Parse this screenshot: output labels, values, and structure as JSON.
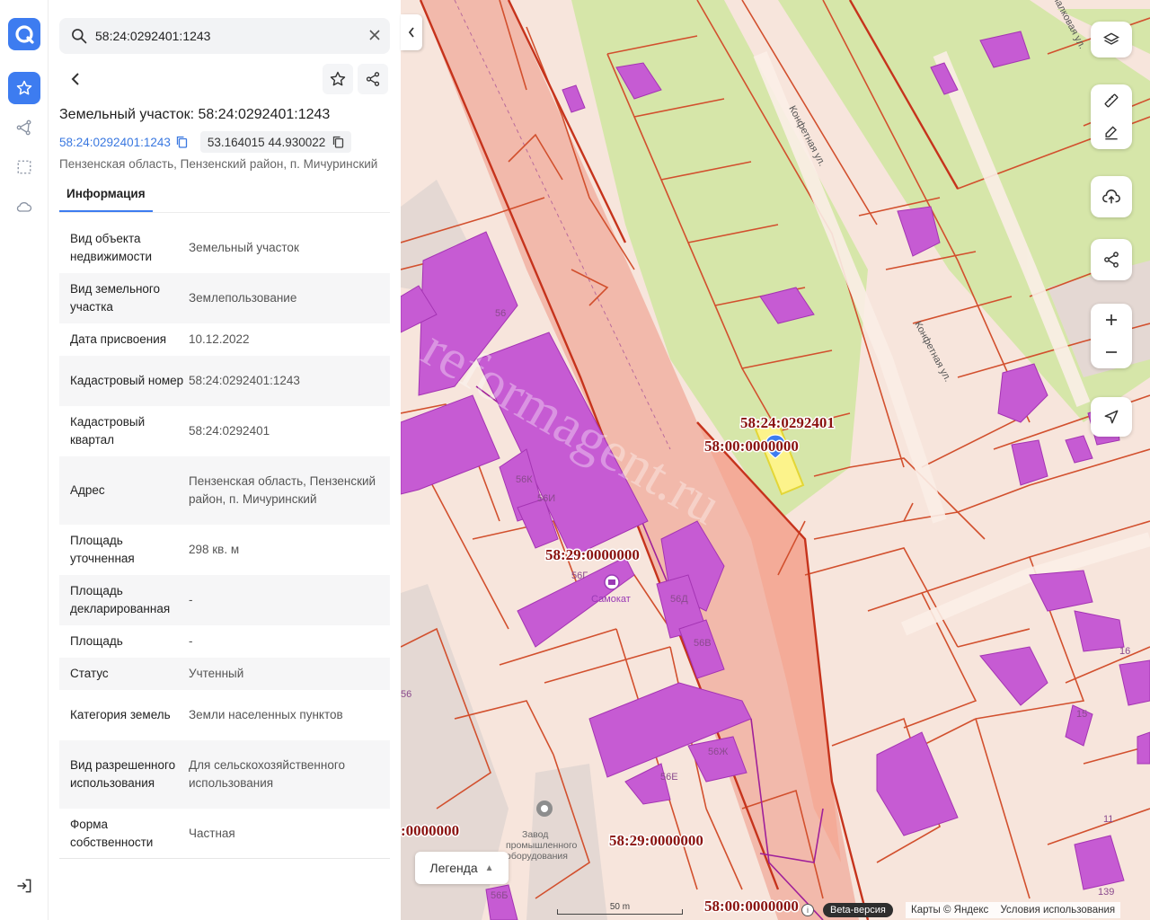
{
  "search": {
    "value": "58:24:0292401:1243"
  },
  "header": {
    "title": "Земельный участок: 58:24:0292401:1243",
    "cad_link": "58:24:0292401:1243",
    "coords": "53.164015 44.930022",
    "address_line": "Пензенская область, Пензенский район, п. Мичуринский"
  },
  "tabs": [
    {
      "label": "Информация"
    }
  ],
  "rows": [
    {
      "key": "Вид объекта недвижимости",
      "value": "Земельный участок"
    },
    {
      "key": "Вид земельного участка",
      "value": "Землепользование"
    },
    {
      "key": "Дата присвоения",
      "value": "10.12.2022"
    },
    {
      "key": "Кадастровый номер",
      "value": "58:24:0292401:1243"
    },
    {
      "key": "Кадастровый квартал",
      "value": "58:24:0292401"
    },
    {
      "key": "Адрес",
      "value": "Пензенская область, Пензенский район, п. Мичуринский"
    },
    {
      "key": "Площадь уточненная",
      "value": "298 кв. м"
    },
    {
      "key": "Площадь декларированная",
      "value": "-"
    },
    {
      "key": "Площадь",
      "value": "-"
    },
    {
      "key": "Статус",
      "value": "Учтенный"
    },
    {
      "key": "Категория земель",
      "value": "Земли населенных пунктов"
    },
    {
      "key": "Вид разрешенного использования",
      "value": "Для сельскохозяйственного использования"
    },
    {
      "key": "Форма собственности",
      "value": "Частная"
    }
  ],
  "map": {
    "labels": {
      "quarter_a": "58:24:0292401",
      "quarter_b": "58:00:0000000",
      "quarter_c": "58:29:0000000",
      "quarter_d": "58:29:0000000",
      "quarter_e": ":0000000",
      "quarter_f": "58:00:0000000"
    },
    "streets": {
      "s1": "Конфетная ул.",
      "s2": "Конфетная ул.",
      "s3": "Фиалковая ул."
    },
    "houses": {
      "h56": "56",
      "h56k": "56К",
      "h56i": "56И",
      "h56g": "56Г",
      "h56d": "56Д",
      "h56v": "56В",
      "h56zh": "56Ж",
      "h56e": "56Е",
      "h56b": "56Б",
      "h56l": "56",
      "h16": "16",
      "h15": "15",
      "h11": "11",
      "h139": "139"
    },
    "poi_samokat": "Самокат",
    "poi_factory": "Завод промышленного оборудования",
    "watermark": "reformagent.ru"
  },
  "legend": {
    "label": "Легенда"
  },
  "scale": {
    "label": "50 m"
  },
  "footer": {
    "beta": "Beta-версия",
    "copyright": "Карты © Яндекс",
    "terms": "Условия использования",
    "info": "i"
  },
  "colors": {
    "accent": "#3d7cf0",
    "parcel_line": "#d2502e",
    "building": "#c65bd3",
    "selected": "#fff48a",
    "green": "#d6e6a9",
    "zone": "#f1b1a2"
  }
}
